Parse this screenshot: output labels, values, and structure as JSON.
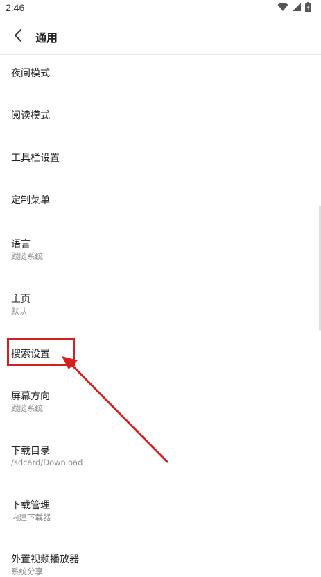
{
  "status_bar": {
    "time": "2:46",
    "icons": [
      "wifi-icon",
      "signal-icon",
      "battery-icon"
    ]
  },
  "toolbar": {
    "title": "通用",
    "back_icon": "chevron-left-icon"
  },
  "settings": [
    {
      "label": "夜间模式",
      "sub": ""
    },
    {
      "label": "阅读模式",
      "sub": ""
    },
    {
      "label": "工具栏设置",
      "sub": ""
    },
    {
      "label": "定制菜单",
      "sub": ""
    },
    {
      "label": "语言",
      "sub": "跟随系统"
    },
    {
      "label": "主页",
      "sub": "默认"
    },
    {
      "label": "搜索设置",
      "sub": ""
    },
    {
      "label": "屏幕方向",
      "sub": "跟随系统"
    },
    {
      "label": "下载目录",
      "sub": "/sdcard/Download"
    },
    {
      "label": "下载管理",
      "sub": "内建下载器"
    },
    {
      "label": "外置视频播放器",
      "sub": "系统分享"
    }
  ],
  "annotation": {
    "highlighted_item": "搜索设置",
    "color": "#d81e1e"
  }
}
